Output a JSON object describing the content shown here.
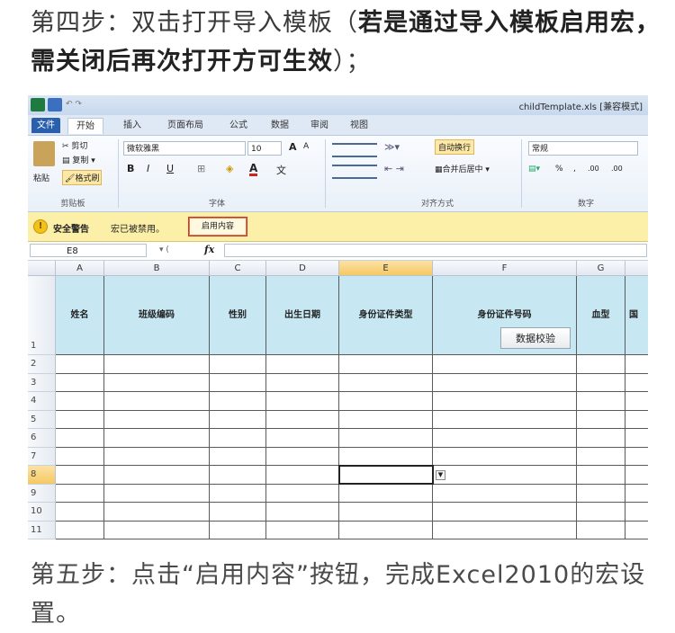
{
  "step4": {
    "prefix": "第四步：双击打开导入模板（",
    "bold": "若是通过导入模板启用宏，需关闭后再次打开方可生效",
    "suffix": "）；"
  },
  "step5": {
    "text": "第五步：点击“启用内容”按钮，完成Excel2010的宏设置。"
  },
  "excel": {
    "title": "childTemplate.xls [兼容模式]",
    "tabs": [
      "文件",
      "开始",
      "插入",
      "页面布局",
      "公式",
      "数据",
      "审阅",
      "视图"
    ],
    "ribbon": {
      "clipboard": {
        "paste": "粘贴",
        "cut": "剪切",
        "copy": "复制 ▾",
        "format_painter": "格式刷",
        "label": "剪贴板"
      },
      "font": {
        "name": "微软雅黑",
        "size": "10",
        "label": "字体",
        "bold": "B",
        "italic": "I",
        "underline": "U",
        "grow": "A",
        "shrink": "A",
        "wen": "文"
      },
      "alignment": {
        "wrap": "自动换行",
        "merge": "合并后居中 ▾",
        "label": "对齐方式"
      },
      "number": {
        "format": "常规",
        "percent": "%",
        "comma": ",",
        "inc": ".00",
        "dec": ".00",
        "label": "数字"
      }
    },
    "security": {
      "title": "安全警告",
      "message": "宏已被禁用。",
      "button": "启用内容"
    },
    "formula": {
      "namebox": "E8",
      "fx": "fx"
    },
    "columns": [
      "A",
      "B",
      "C",
      "D",
      "E",
      "F",
      "G"
    ],
    "header_row": [
      "姓名",
      "班级编码",
      "性别",
      "出生日期",
      "身份证件类型",
      "身份证件号码",
      "血型",
      "国"
    ],
    "row_numbers": [
      "1",
      "2",
      "3",
      "4",
      "5",
      "6",
      "7",
      "8",
      "9",
      "10",
      "11"
    ],
    "validate_button": "数据校验"
  }
}
